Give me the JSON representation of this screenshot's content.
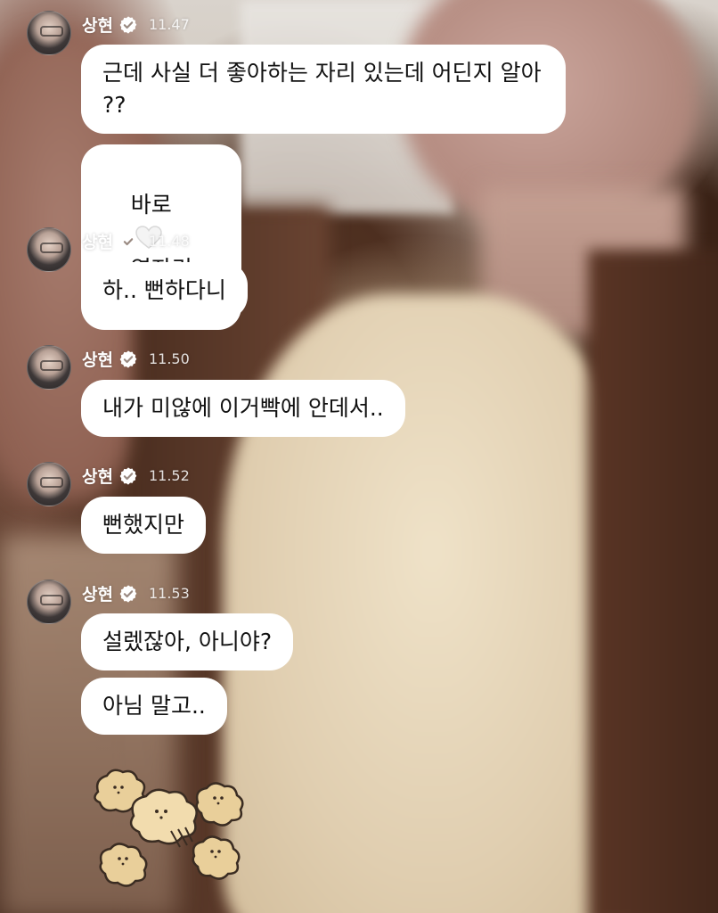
{
  "colors": {
    "bubble_bg": "#ffffff",
    "bubble_text": "#111111",
    "name_text": "#ffffff",
    "verified_badge": "#ffffff"
  },
  "groups": [
    {
      "sender": "상현",
      "time": "11.47",
      "messages": [
        "근데 사실 더 좋아하는 자리 있는데 어딘지 알아\n??"
      ]
    },
    {
      "heart_message": {
        "before": "바로",
        "after": "옆자리 ㅋ",
        "icon": "white-heart-icon"
      }
    },
    {
      "sender": "상현",
      "time": "11.48",
      "messages": [
        "하.. 뻔하다니"
      ]
    },
    {
      "sender": "상현",
      "time": "11.50",
      "messages": [
        "내가 미않에 이거빡에 안데서.."
      ]
    },
    {
      "sender": "상현",
      "time": "11.52",
      "messages": [
        "뻔했지만"
      ]
    },
    {
      "sender": "상현",
      "time": "11.53",
      "messages": [
        "설렜잖아, 아니야?",
        "아님 말고.."
      ]
    }
  ],
  "sticker": {
    "icon": "bread-puppies-sticker"
  }
}
